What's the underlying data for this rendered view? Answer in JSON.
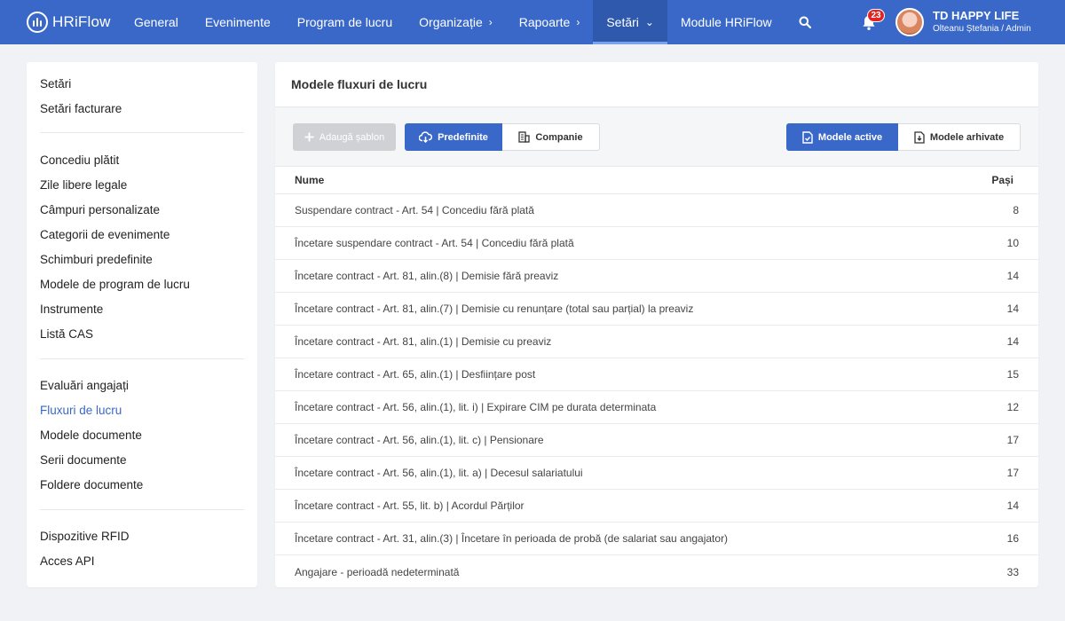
{
  "app": {
    "name": "HRiFlow"
  },
  "nav": [
    {
      "label": "General",
      "has_chevron": false,
      "active": false
    },
    {
      "label": "Evenimente",
      "has_chevron": false,
      "active": false
    },
    {
      "label": "Program de lucru",
      "has_chevron": false,
      "active": false
    },
    {
      "label": "Organizație",
      "has_chevron": true,
      "chevron": "›",
      "active": false
    },
    {
      "label": "Rapoarte",
      "has_chevron": true,
      "chevron": "›",
      "active": false
    },
    {
      "label": "Setări",
      "has_chevron": true,
      "chevron": "⌄",
      "active": true
    },
    {
      "label": "Module HRiFlow",
      "has_chevron": false,
      "active": false
    }
  ],
  "notifications": {
    "count": "23",
    "icon": "bell-icon"
  },
  "user": {
    "company": "TD HAPPY LIFE",
    "name_role": "Olteanu Ștefania / Admin"
  },
  "sidebar": {
    "groups": [
      {
        "items": [
          {
            "label": "Setări"
          },
          {
            "label": "Setări facturare"
          }
        ]
      },
      {
        "items": [
          {
            "label": "Concediu plătit"
          },
          {
            "label": "Zile libere legale"
          },
          {
            "label": "Câmpuri personalizate"
          },
          {
            "label": "Categorii de evenimente"
          },
          {
            "label": "Schimburi predefinite"
          },
          {
            "label": "Modele de program de lucru"
          },
          {
            "label": "Instrumente"
          },
          {
            "label": "Listă CAS"
          }
        ]
      },
      {
        "items": [
          {
            "label": "Evaluări angajați"
          },
          {
            "label": "Fluxuri de lucru",
            "active": true
          },
          {
            "label": "Modele documente"
          },
          {
            "label": "Serii documente"
          },
          {
            "label": "Foldere documente"
          }
        ]
      },
      {
        "items": [
          {
            "label": "Dispozitive RFID"
          },
          {
            "label": "Acces API"
          }
        ]
      }
    ]
  },
  "main": {
    "title": "Modele fluxuri de lucru",
    "toolbar": {
      "add_template": "Adaugă șablon",
      "predefined": "Predefinite",
      "company": "Companie",
      "active_models": "Modele active",
      "archived_models": "Modele arhivate"
    },
    "table": {
      "headers": {
        "name": "Nume",
        "steps": "Pași"
      },
      "rows": [
        {
          "name": "Suspendare contract - Art. 54 | Concediu fără plată",
          "steps": "8"
        },
        {
          "name": "Încetare suspendare contract - Art. 54 | Concediu fără plată",
          "steps": "10"
        },
        {
          "name": "Încetare contract - Art. 81, alin.(8) | Demisie fără preaviz",
          "steps": "14"
        },
        {
          "name": "Încetare contract - Art. 81, alin.(7) | Demisie cu renunțare (total sau parțial) la preaviz",
          "steps": "14"
        },
        {
          "name": "Încetare contract - Art. 81, alin.(1) | Demisie cu preaviz",
          "steps": "14"
        },
        {
          "name": "Încetare contract - Art. 65, alin.(1) | Desființare post",
          "steps": "15"
        },
        {
          "name": "Încetare contract - Art. 56, alin.(1), lit. i) | Expirare CIM pe durata determinata",
          "steps": "12"
        },
        {
          "name": "Încetare contract - Art. 56, alin.(1), lit. c) | Pensionare",
          "steps": "17"
        },
        {
          "name": "Încetare contract - Art. 56, alin.(1), lit. a) | Decesul salariatului",
          "steps": "17"
        },
        {
          "name": "Încetare contract - Art. 55, lit. b) | Acordul Părților",
          "steps": "14"
        },
        {
          "name": "Încetare contract - Art. 31, alin.(3) | Încetare în perioada de probă (de salariat sau angajator)",
          "steps": "16"
        },
        {
          "name": "Angajare - perioadă nedeterminată",
          "steps": "33"
        }
      ]
    }
  },
  "colors": {
    "primary": "#3a68c8",
    "nav_active": "#2f59ad",
    "badge": "#e02424",
    "background": "#f0f2f5"
  }
}
